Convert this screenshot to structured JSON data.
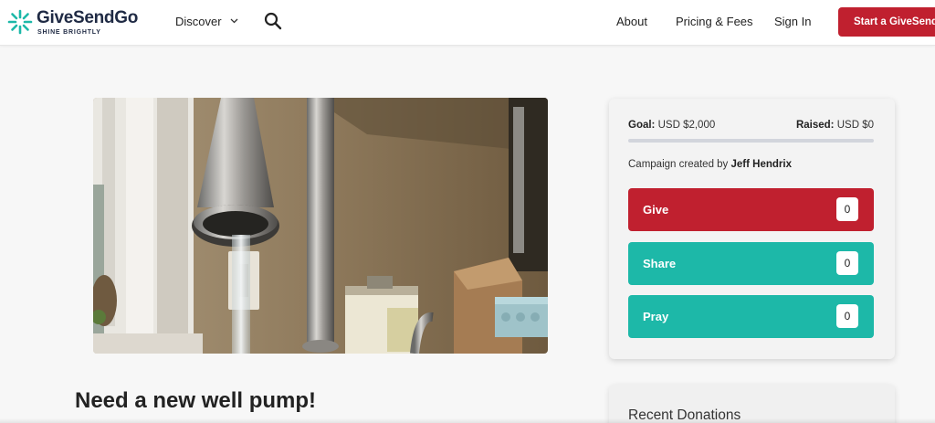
{
  "header": {
    "logo_name": "GiveSendGo",
    "logo_tagline": "SHINE BRIGHTLY",
    "discover_label": "Discover",
    "nav": {
      "about": "About",
      "pricing": "Pricing & Fees",
      "sign_in": "Sign In"
    },
    "start_button": "Start a GiveSendGo",
    "icons": [
      "search-icon",
      "chevron-down-icon"
    ]
  },
  "campaign": {
    "title": "Need a new well pump!"
  },
  "sidebar": {
    "goal_label": "Goal:",
    "goal_value": "USD $2,000",
    "raised_label": "Raised:",
    "raised_value": "USD $0",
    "progress_fraction": 0,
    "creator_prefix": "Campaign created by",
    "creator_name": "Jeff Hendrix",
    "actions": {
      "give": {
        "label": "Give",
        "count": "0"
      },
      "share": {
        "label": "Share",
        "count": "0"
      },
      "pray": {
        "label": "Pray",
        "count": "0"
      }
    },
    "recent_donations_title": "Recent Donations"
  },
  "colors": {
    "brand_red": "#c0202f",
    "brand_teal": "#1db8a8",
    "logo_navy": "#1f2a44"
  }
}
